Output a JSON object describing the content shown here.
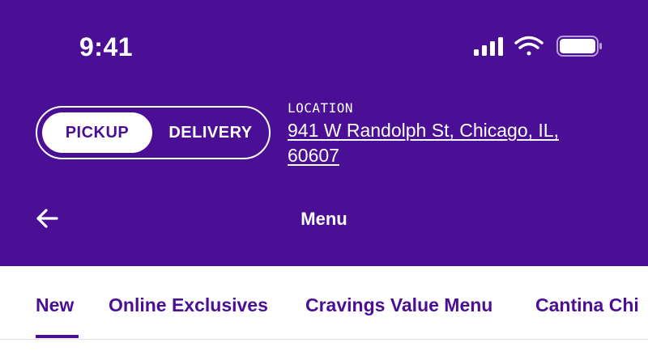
{
  "status_bar": {
    "time": "9:41",
    "icons": [
      "signal-icon",
      "wifi-icon",
      "battery-icon"
    ]
  },
  "order_mode": {
    "options": [
      "PICKUP",
      "DELIVERY"
    ],
    "selected": "PICKUP"
  },
  "location": {
    "label": "LOCATION",
    "address": "941 W Randolph St, Chicago, IL, 60607"
  },
  "nav": {
    "back_icon": "back-arrow-icon",
    "title": "Menu"
  },
  "tabs": [
    {
      "label": "New",
      "active": true
    },
    {
      "label": "Online Exclusives",
      "active": false
    },
    {
      "label": "Cravings Value Menu",
      "active": false
    },
    {
      "label": "Cantina Chi",
      "active": false
    }
  ],
  "colors": {
    "brand": "#4a0f94",
    "on_brand": "#ffffff",
    "divider": "#e3e3e3"
  }
}
